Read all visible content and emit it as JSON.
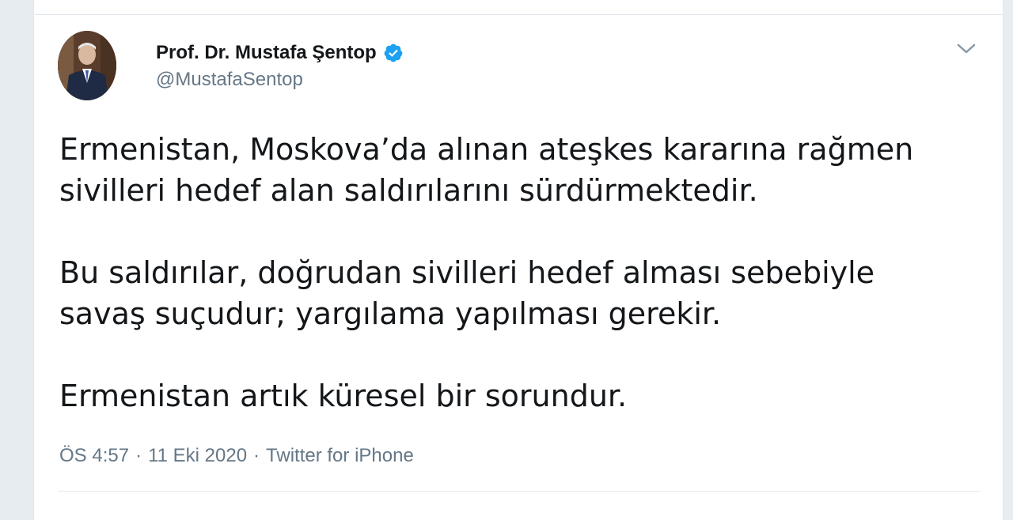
{
  "tweet": {
    "author": {
      "display_name": "Prof. Dr. Mustafa Şentop",
      "handle": "@MustafaSentop",
      "verified": true
    },
    "paragraphs": [
      {
        "line1": "Ermenistan, Moskova’da alınan ateşkes kararına rağmen",
        "line2": "sivilleri hedef alan saldırılarını sürdürmektedir."
      },
      {
        "line1": "Bu saldırılar, doğrudan sivilleri hedef alması sebebiyle",
        "line2": "savaş suçudur; yargılama yapılması gerekir."
      },
      {
        "line1": "Ermenistan artık küresel bir sorundur.",
        "line2": ""
      }
    ],
    "meta": {
      "time": "ÖS 4:57",
      "date": "11 Eki 2020",
      "source": "Twitter for iPhone",
      "separator": "·"
    }
  },
  "colors": {
    "background": "#e6ecf0",
    "card": "#ffffff",
    "text_primary": "#14171a",
    "text_secondary": "#657786",
    "verified_blue": "#1da1f2"
  },
  "icons": {
    "verified": "verified-badge-icon",
    "menu": "chevron-down-icon"
  }
}
